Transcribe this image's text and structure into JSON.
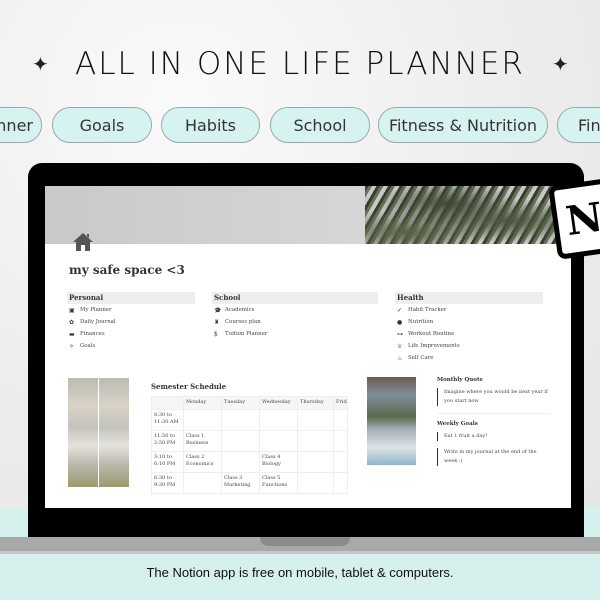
{
  "header": {
    "title": "ALL IN ONE LIFE PLANNER",
    "sparkle_icon": "sparkle-icon"
  },
  "pills": [
    {
      "label": "Planner"
    },
    {
      "label": "Goals"
    },
    {
      "label": "Habits"
    },
    {
      "label": "School"
    },
    {
      "label": "Fitness & Nutrition"
    },
    {
      "label": "Finance"
    }
  ],
  "notion_page": {
    "home_icon": "home-icon",
    "title": "my safe space <3",
    "sections": [
      {
        "heading": "Personal",
        "items": [
          {
            "icon": "planner-icon",
            "glyph": "▣",
            "label": "My Planner"
          },
          {
            "icon": "journal-icon",
            "glyph": "✿",
            "label": "Daily Journal"
          },
          {
            "icon": "finances-icon",
            "glyph": "▬",
            "label": "Finances"
          },
          {
            "icon": "goals-icon",
            "glyph": "✧",
            "label": "Goals"
          }
        ]
      },
      {
        "heading": "School",
        "items": [
          {
            "icon": "academics-icon",
            "glyph": "🎓",
            "label": "Academics"
          },
          {
            "icon": "courses-icon",
            "glyph": "♜",
            "label": "Courses plan"
          },
          {
            "icon": "dollar-icon",
            "glyph": "$",
            "label": "Tuition Planner"
          }
        ]
      },
      {
        "heading": "Health",
        "items": [
          {
            "icon": "check-icon",
            "glyph": "✓",
            "label": "Habit Tracker"
          },
          {
            "icon": "apple-icon",
            "glyph": "●",
            "label": "Nutrition"
          },
          {
            "icon": "dumbbell-icon",
            "glyph": "⊶",
            "label": "Workout Routine"
          },
          {
            "icon": "trophy-icon",
            "glyph": "♕",
            "label": "Life Improvements"
          },
          {
            "icon": "bath-icon",
            "glyph": "♨",
            "label": "Self Care"
          }
        ]
      }
    ],
    "schedule": {
      "title": "Semester Schedule",
      "columns": [
        "",
        "Monday",
        "Tuesday",
        "Wednesday",
        "Thursday",
        "Friday"
      ],
      "rows": [
        [
          "8:30 to 11:30 AM",
          "",
          "",
          "",
          "",
          ""
        ],
        [
          "11:50 to 2:50 PM",
          "Class 1 Business",
          "",
          "",
          "",
          ""
        ],
        [
          "3:10 to 6:10 PM",
          "Class 2 Economics",
          "",
          "Class 4 Biology",
          "",
          ""
        ],
        [
          "6:30 to 9:30 PM",
          "",
          "Class 3 Marketing",
          "Class 5 Functions",
          "",
          ""
        ]
      ]
    },
    "monthly_quote": {
      "heading": "Monthly Quote",
      "text": "Imagine where you would be next year if you start now"
    },
    "weekly_goals": {
      "heading": "Weekly Goals",
      "items": [
        "Eat 1 fruit a day!",
        "Write in my journal at the end of the week :)"
      ]
    }
  },
  "footer": {
    "caption": "The Notion app is free on mobile, tablet & computers."
  },
  "colors": {
    "pill_bg": "#d7f3f1",
    "bottom_band": "#d6f0ee"
  }
}
